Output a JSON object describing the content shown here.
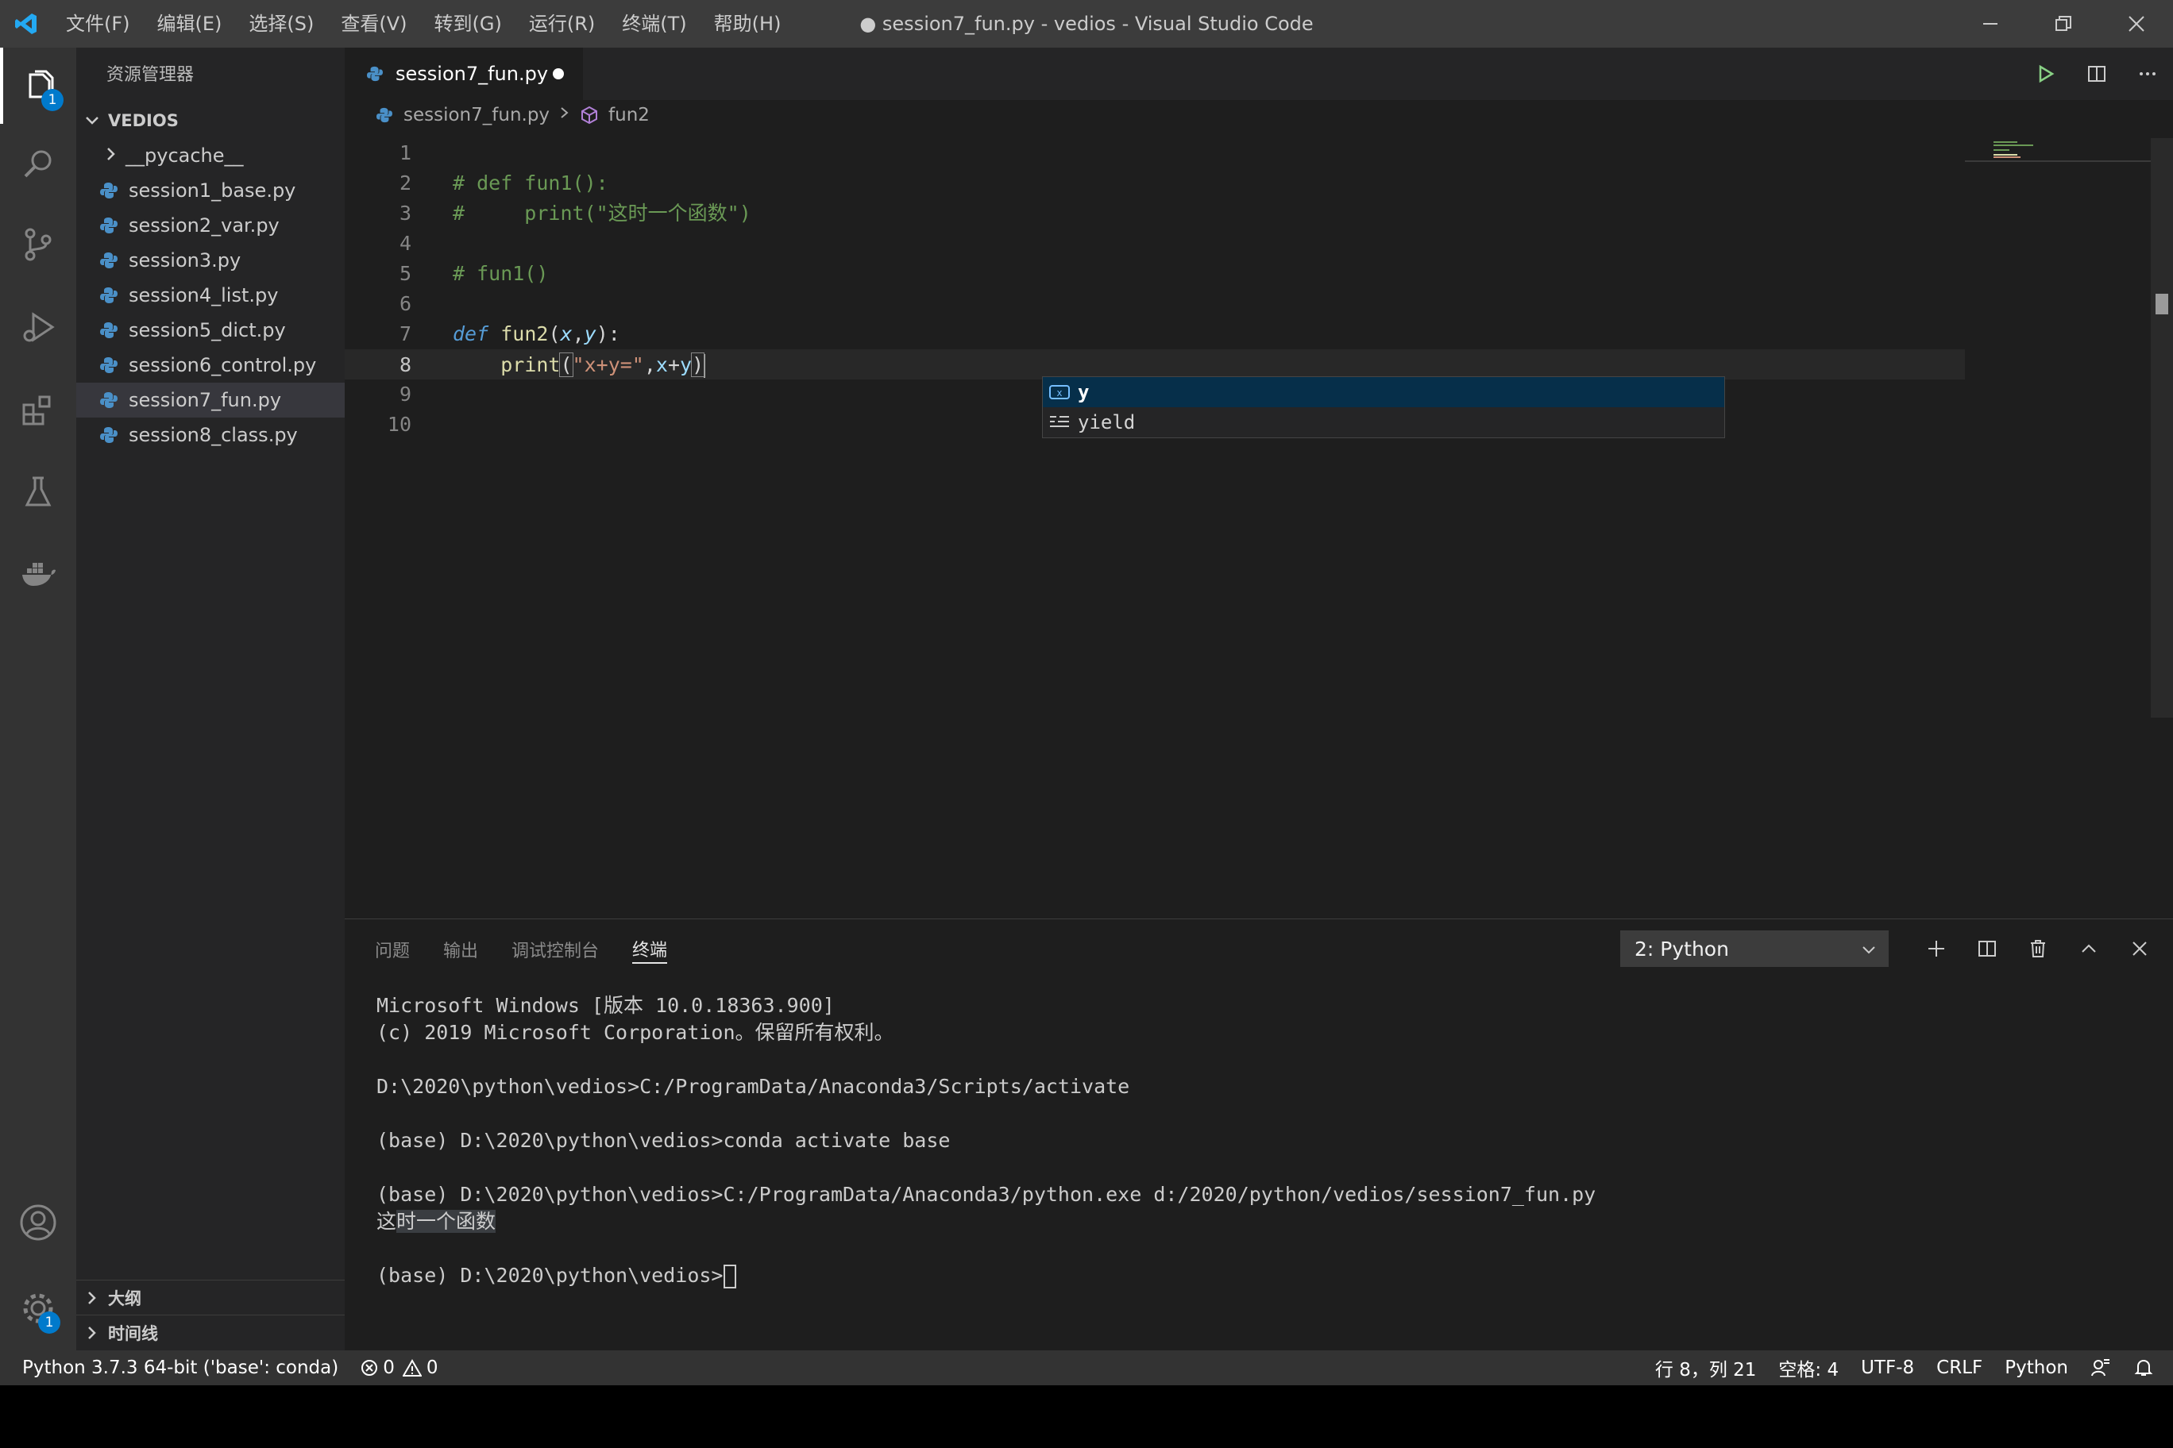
{
  "window": {
    "title": "● session7_fun.py - vedios - Visual Studio Code",
    "menu": [
      "文件(F)",
      "编辑(E)",
      "选择(S)",
      "查看(V)",
      "转到(G)",
      "运行(R)",
      "终端(T)",
      "帮助(H)"
    ]
  },
  "activity_bar": {
    "icons": [
      "explorer-icon",
      "search-icon",
      "source-control-icon",
      "run-debug-icon",
      "extensions-icon",
      "testing-icon",
      "docker-icon",
      "account-icon",
      "settings-gear-icon"
    ],
    "explorer_badge": "1",
    "settings_badge": "1"
  },
  "sidebar": {
    "title": "资源管理器",
    "folder": "VEDIOS",
    "items": [
      {
        "label": "__pycache__",
        "type": "folder"
      },
      {
        "label": "session1_base.py",
        "type": "python"
      },
      {
        "label": "session2_var.py",
        "type": "python"
      },
      {
        "label": "session3.py",
        "type": "python"
      },
      {
        "label": "session4_list.py",
        "type": "python"
      },
      {
        "label": "session5_dict.py",
        "type": "python"
      },
      {
        "label": "session6_control.py",
        "type": "python"
      },
      {
        "label": "session7_fun.py",
        "type": "python",
        "selected": true
      },
      {
        "label": "session8_class.py",
        "type": "python"
      }
    ],
    "outline": "大纲",
    "timeline": "时间线"
  },
  "editor": {
    "tab": {
      "label": "session7_fun.py",
      "dirty": true
    },
    "breadcrumb": {
      "file": "session7_fun.py",
      "symbol": "fun2"
    },
    "current_line": 8,
    "lines": [
      "1",
      "2",
      "3",
      "4",
      "5",
      "6",
      "7",
      "8",
      "9",
      "10"
    ],
    "code": {
      "l2": "# def fun1():",
      "l3": "#     print(\"这时一个函数\")",
      "l5": "# fun1()",
      "l7_kw": "def",
      "l7_fn": "fun2",
      "l7_p1": "x",
      "l7_p2": "y",
      "l8_fn": "print",
      "l8_str": "\"x+y=\""
    },
    "suggestions": [
      {
        "label": "y",
        "kind": "variable-icon",
        "selected": true
      },
      {
        "label": "yield",
        "kind": "keyword-icon",
        "selected": false
      }
    ]
  },
  "panel": {
    "tabs": [
      "问题",
      "输出",
      "调试控制台",
      "终端"
    ],
    "active_tab": "终端",
    "terminal_select": "2: Python",
    "terminal_lines": {
      "t1": "Microsoft Windows [版本 10.0.18363.900]",
      "t2": "(c) 2019 Microsoft Corporation。保留所有权利。",
      "t3": "D:\\2020\\python\\vedios>C:/ProgramData/Anaconda3/Scripts/activate",
      "t4": "(base) D:\\2020\\python\\vedios>conda activate base",
      "t5": "(base) D:\\2020\\python\\vedios>C:/ProgramData/Anaconda3/python.exe d:/2020/python/vedios/session7_fun.py",
      "t6a": "这",
      "t6b": "时一个函数",
      "t7": "(base) D:\\2020\\python\\vedios>"
    }
  },
  "status_bar": {
    "interpreter": "Python 3.7.3 64-bit ('base': conda)",
    "errors": "0",
    "warnings": "0",
    "position": "行 8，列 21",
    "indent": "空格: 4",
    "encoding": "UTF-8",
    "eol": "CRLF",
    "language": "Python"
  },
  "colors": {
    "accent": "#007acc",
    "python_icon": "#4a90c8",
    "statusbar": "#333333"
  }
}
